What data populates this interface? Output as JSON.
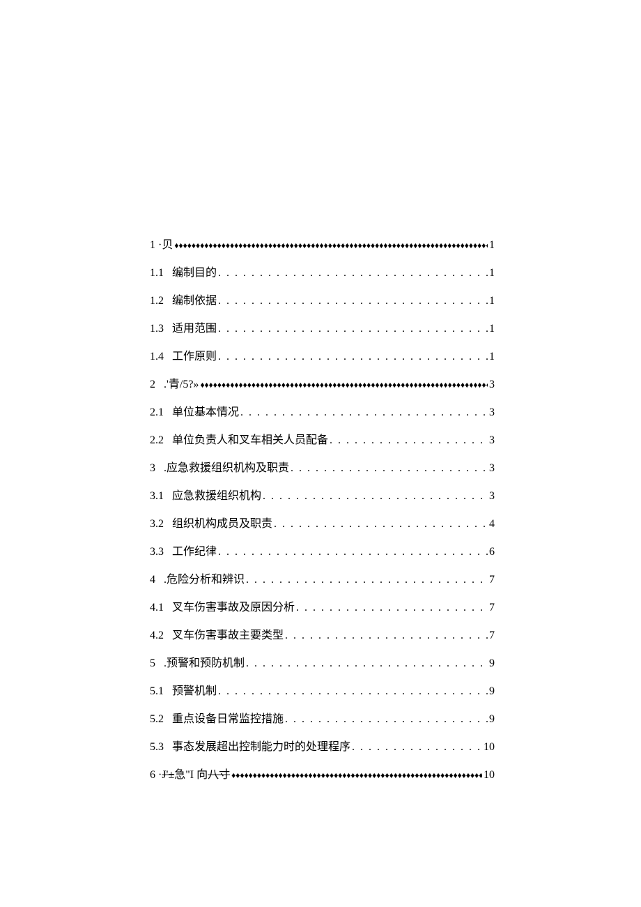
{
  "toc": [
    {
      "number": "1",
      "title": "·贝",
      "page": "1",
      "leader": "diamond",
      "tight": true
    },
    {
      "number": "1.1",
      "title": "编制目的",
      "page": "1",
      "leader": "dot"
    },
    {
      "number": "1.2",
      "title": "编制依据",
      "page": "1",
      "leader": "dot"
    },
    {
      "number": "1.3",
      "title": "适用范围",
      "page": "1",
      "leader": "dot"
    },
    {
      "number": "1.4",
      "title": "工作原则",
      "page": "1",
      "leader": "dot"
    },
    {
      "number": "2",
      "title": ".'青/5?»",
      "page": "3",
      "leader": "diamond"
    },
    {
      "number": "2.1",
      "title": "单位基本情况",
      "page": "3",
      "leader": "dot"
    },
    {
      "number": "2.2",
      "title": "单位负责人和叉车相关人员配备",
      "page": "3",
      "leader": "dot"
    },
    {
      "number": "3",
      "title": ".应急救援组织机构及职责",
      "page": "3",
      "leader": "dot"
    },
    {
      "number": "3.1",
      "title": "应急救援组织机构",
      "page": "3",
      "leader": "dot"
    },
    {
      "number": "3.2",
      "title": "组织机构成员及职责",
      "page": "4",
      "leader": "dot"
    },
    {
      "number": "3.3",
      "title": "工作纪律",
      "page": "6",
      "leader": "dot"
    },
    {
      "number": "4",
      "title": ".危险分析和辨识 ",
      "page": "7",
      "leader": "dot"
    },
    {
      "number": "4.1",
      "title": "叉车伤害事故及原因分析",
      "page": "7",
      "leader": "dot"
    },
    {
      "number": "4.2",
      "title": "叉车伤害事故主要类型",
      "page": "7",
      "leader": "dot"
    },
    {
      "number": "5",
      "title": ".预警和预防机制",
      "page": "9",
      "leader": "dot"
    },
    {
      "number": "5.1",
      "title": "预警机制",
      "page": "9",
      "leader": "dot"
    },
    {
      "number": "5.2",
      "title": "重点设备日常监控措施",
      "page": "9",
      "leader": "dot"
    },
    {
      "number": "5.3",
      "title": "事态发展超出控制能力时的处理程序",
      "page": "10",
      "leader": "dot"
    },
    {
      "number": "6",
      "title_html": true,
      "title_pre": "·",
      "title_strike1": "J'±",
      "title_mid": "急\"I 向",
      "title_strike2": "八寸",
      "page": "10",
      "leader": "diamond",
      "tight": true
    }
  ],
  "leaders": {
    "dot": ". . . . . . . . . . . . . . . . . . . . . . . . . . . . . . . . . . . . . . . . . . . . . . . . . . . . . . . . . . . . . . . . . . . . . . . . . . . . . . . .",
    "diamond": "♦♦♦♦♦♦♦♦♦♦♦♦♦♦♦♦♦♦♦♦♦♦♦♦♦♦♦♦♦♦♦♦♦♦♦♦♦♦♦♦♦♦♦♦♦♦♦♦♦♦♦♦♦♦♦♦♦♦♦♦♦♦♦♦♦♦♦♦♦♦♦♦♦♦♦♦♦♦♦♦"
  }
}
